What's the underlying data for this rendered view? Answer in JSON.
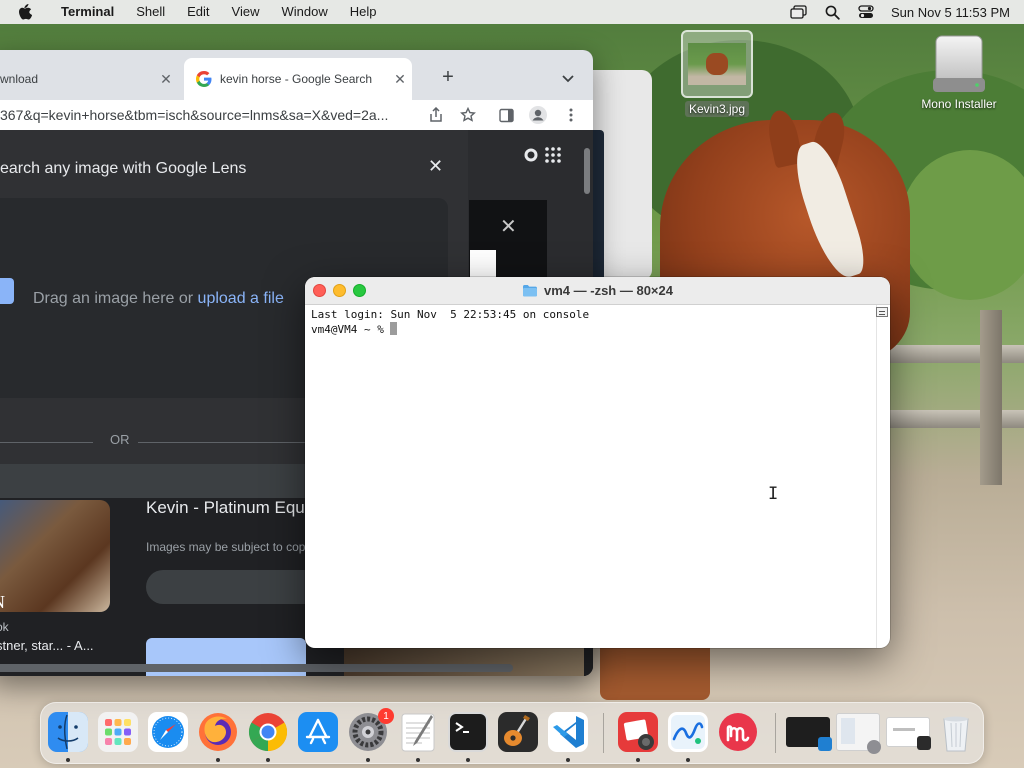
{
  "menubar": {
    "app_name": "Terminal",
    "menus": [
      "Shell",
      "Edit",
      "View",
      "Window",
      "Help"
    ],
    "clock": "Sun Nov 5  11:53 PM"
  },
  "chrome": {
    "tabs": [
      {
        "title": "wnload",
        "active": false
      },
      {
        "title": "kevin horse - Google Search",
        "active": true
      }
    ],
    "url": "367&q=kevin+horse&tbm=isch&source=lnms&sa=X&ved=2a...",
    "lens": {
      "title": "earch any image with Google Lens",
      "drop_text": "Drag an image here or",
      "upload_link": "upload a file",
      "or_text": "OR"
    },
    "result": {
      "thumb_letter": "N",
      "sub1": "ok",
      "sub2": "stner, star... - A...",
      "title": "Kevin - Platinum Equ",
      "note": "Images may be subject to cop"
    }
  },
  "desktop": {
    "icons": [
      {
        "label": "Kevin3.jpg"
      },
      {
        "label": "Mono Installer"
      }
    ]
  },
  "terminal": {
    "title": "vm4 — -zsh — 80×24",
    "lines": [
      "Last login: Sun Nov  5 22:53:45 on console",
      "vm4@VM4 ~ % "
    ]
  },
  "dock": {
    "apps": [
      "Finder",
      "Launchpad",
      "Safari",
      "Firefox",
      "Google Chrome",
      "App Store",
      "System Settings",
      "TextEdit",
      "Terminal",
      "GarageBand",
      "Visual Studio Code",
      "Photo Booth",
      "Freeform",
      "Monosnap"
    ],
    "settings_badge": "1",
    "colors": {
      "finder": "#2f8cf0",
      "terminal": "#1c1c1c",
      "vscode": "#1f7fd1",
      "chrome_red": "#ea4335",
      "chrome_yellow": "#fbbc05",
      "chrome_green": "#34a853",
      "chrome_blue": "#4285f4"
    }
  }
}
